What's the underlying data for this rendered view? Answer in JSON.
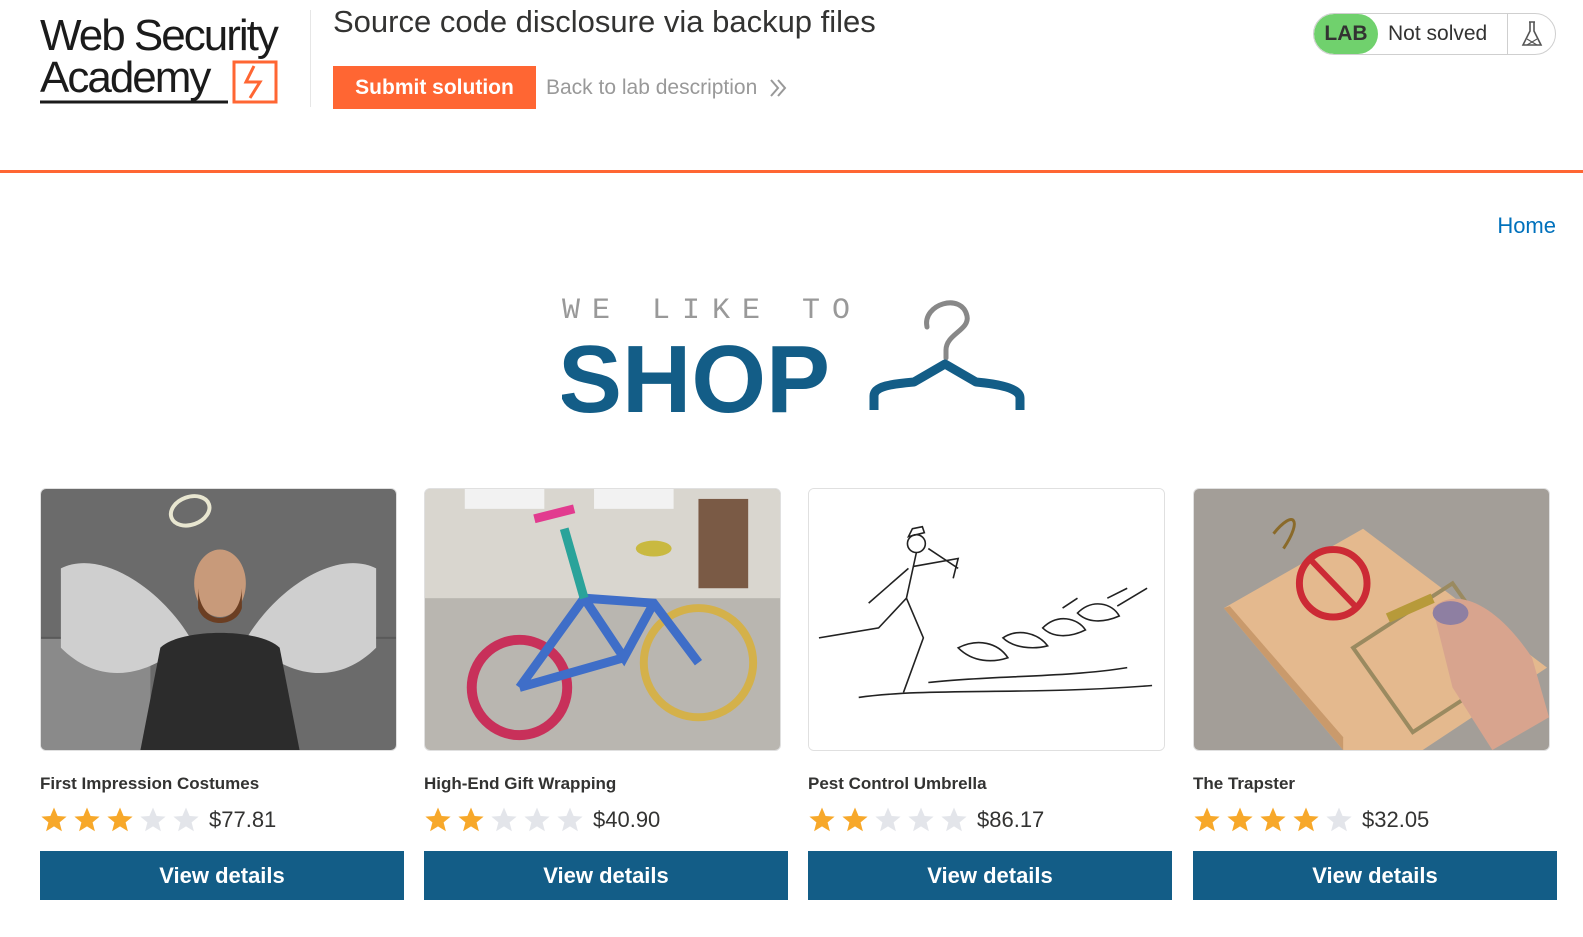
{
  "academy_header": {
    "logo_text_line1": "Web Security",
    "logo_text_line2": "Academy",
    "lab_title": "Source code disclosure via backup files",
    "submit_label": "Submit solution",
    "back_label": "Back to lab description",
    "status_badge": "LAB",
    "status_text": "Not solved",
    "status_icon": "flask-icon"
  },
  "nav": {
    "home_label": "Home"
  },
  "banner": {
    "tagline": "WE LIKE TO",
    "headline": "SHOP",
    "icon": "hanger-icon"
  },
  "colors": {
    "accent": "#ff6633",
    "primary": "#135d87",
    "link": "#0071bc",
    "lab_badge": "#70d16d",
    "star_on": "#f7a82a",
    "star_off": "#e3e5ea"
  },
  "products": [
    {
      "name": "First Impression Costumes",
      "rating": 3,
      "price": "$77.81",
      "button": "View details",
      "image": "angel-costume-photo"
    },
    {
      "name": "High-End Gift Wrapping",
      "rating": 2,
      "price": "$40.90",
      "button": "View details",
      "image": "knitted-bicycle-photo"
    },
    {
      "name": "Pest Control Umbrella",
      "rating": 2,
      "price": "$86.17",
      "button": "View details",
      "image": "pied-piper-drawing"
    },
    {
      "name": "The Trapster",
      "rating": 4,
      "price": "$32.05",
      "button": "View details",
      "image": "mousetrap-photo"
    }
  ]
}
